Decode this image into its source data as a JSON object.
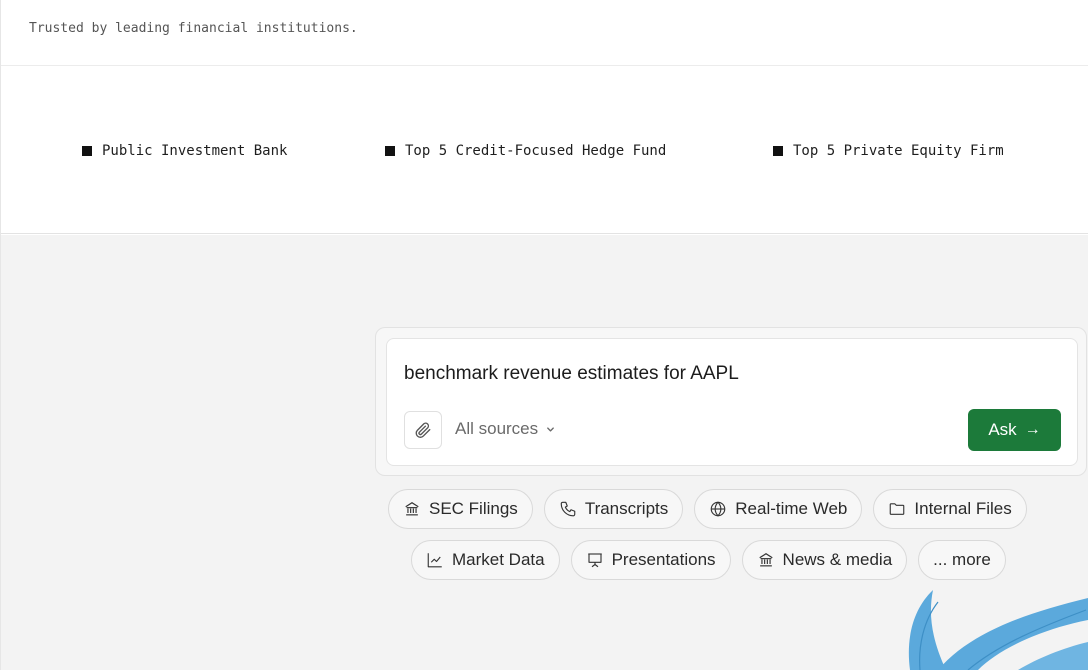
{
  "trusted": {
    "text": "Trusted by leading financial institutions."
  },
  "clients": [
    {
      "name": "Public Investment Bank"
    },
    {
      "name": "Top 5 Credit-Focused Hedge Fund"
    },
    {
      "name": "Top 5 Private Equity Firm"
    }
  ],
  "search": {
    "query": "benchmark revenue estimates for AAPL",
    "sources_label": "All sources",
    "ask_label": "Ask",
    "ask_arrow": "→"
  },
  "chips": {
    "row1": [
      {
        "label": "SEC Filings",
        "icon": "bank-icon"
      },
      {
        "label": "Transcripts",
        "icon": "phone-icon"
      },
      {
        "label": "Real-time Web",
        "icon": "globe-icon"
      },
      {
        "label": "Internal Files",
        "icon": "folder-icon"
      }
    ],
    "row2": [
      {
        "label": "Market Data",
        "icon": "chart-icon"
      },
      {
        "label": "Presentations",
        "icon": "presentation-icon"
      },
      {
        "label": "News & media",
        "icon": "bank-icon"
      },
      {
        "label": "... more",
        "icon": ""
      }
    ]
  },
  "colors": {
    "accent": "#1c7a3a",
    "demo_bg": "#f3f3f3",
    "bird": "#5ba9dc"
  }
}
